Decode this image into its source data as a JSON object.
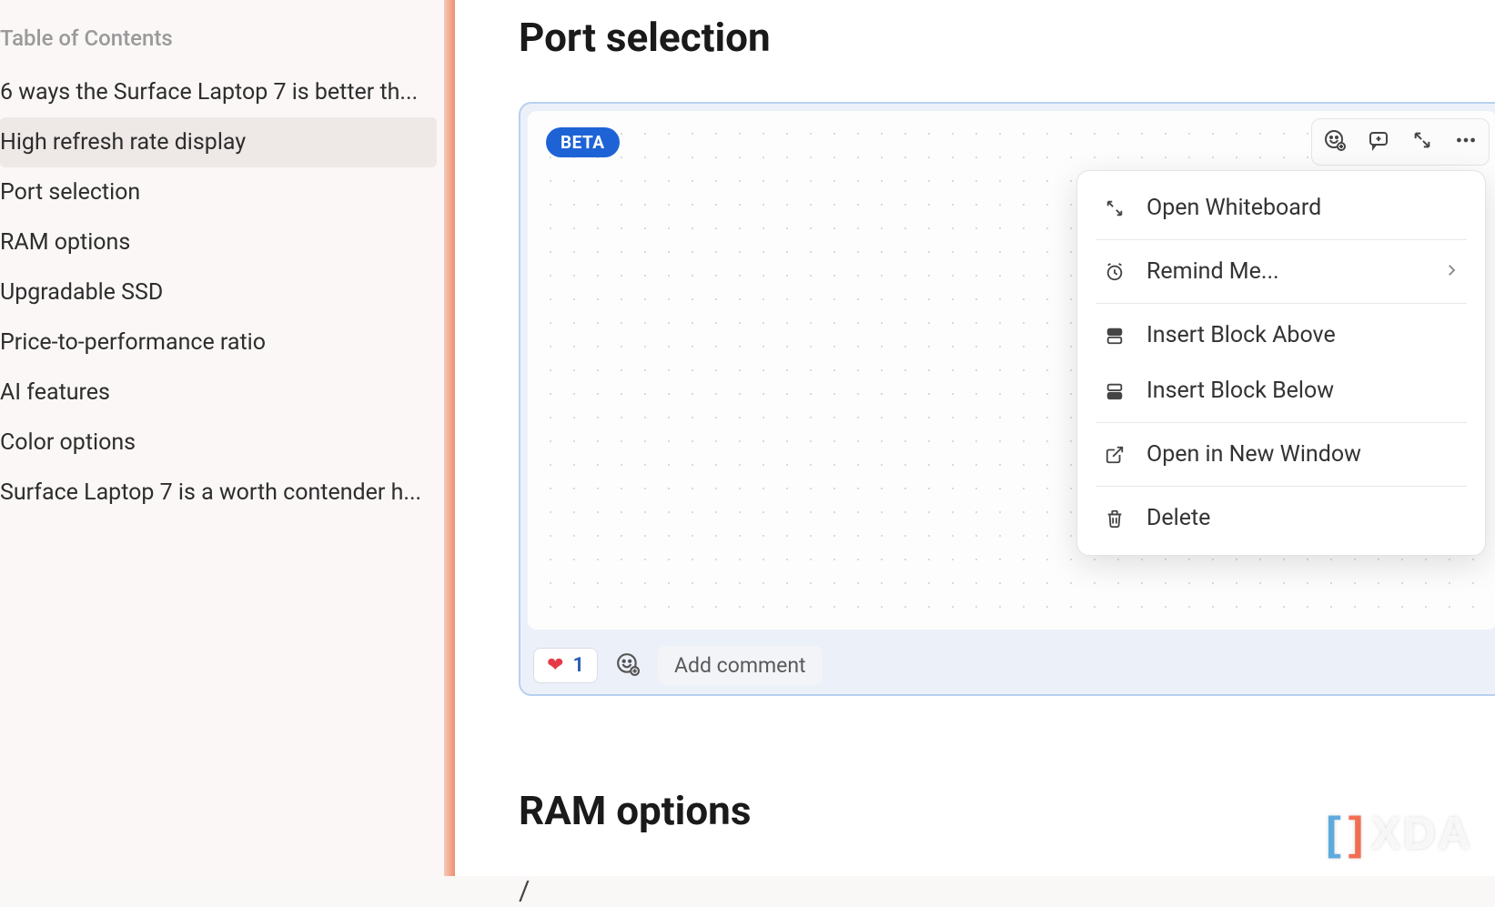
{
  "sidebar": {
    "title": "Table of Contents",
    "items": [
      {
        "label": "6 ways the Surface Laptop 7 is better th...",
        "active": false
      },
      {
        "label": "High refresh rate display",
        "active": true
      },
      {
        "label": "Port selection",
        "active": false
      },
      {
        "label": "RAM options",
        "active": false
      },
      {
        "label": "Upgradable SSD",
        "active": false
      },
      {
        "label": "Price-to-performance ratio",
        "active": false
      },
      {
        "label": "AI features",
        "active": false
      },
      {
        "label": "Color options",
        "active": false
      },
      {
        "label": "Surface Laptop 7 is a worth contender h...",
        "active": false
      }
    ]
  },
  "main": {
    "heading1": "Port selection",
    "heading2": "RAM options",
    "slash": "/"
  },
  "whiteboard": {
    "badge": "BETA",
    "reaction_count": "1",
    "add_comment": "Add comment"
  },
  "menu": {
    "open_whiteboard": "Open Whiteboard",
    "remind_me": "Remind Me...",
    "insert_above": "Insert Block Above",
    "insert_below": "Insert Block Below",
    "open_new_window": "Open in New Window",
    "delete": "Delete"
  },
  "watermark": "XDA"
}
